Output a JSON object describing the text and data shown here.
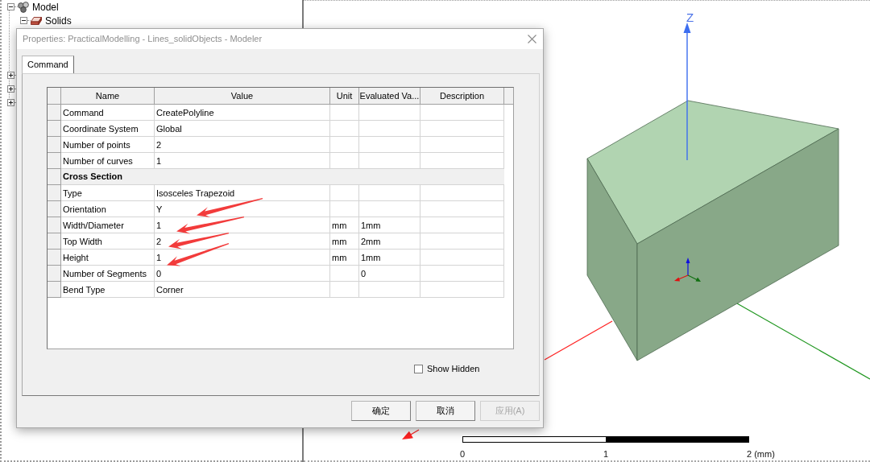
{
  "tree": {
    "items": [
      {
        "label": "Model",
        "expanded": true,
        "children": [
          {
            "label": "Solids",
            "expanded": true
          }
        ]
      },
      {
        "expanded": false
      },
      {
        "expanded": false
      },
      {
        "expanded": false
      }
    ]
  },
  "dialog": {
    "title": "Properties: PracticalModelling - Lines_solidObjects - Modeler",
    "tabs": [
      {
        "label": "Command",
        "selected": true
      }
    ],
    "table": {
      "columns": [
        "Name",
        "Value",
        "Unit",
        "Evaluated Va...",
        "Description"
      ],
      "rows": [
        {
          "kind": "property",
          "name": "Command",
          "value": "CreatePolyline",
          "arrow": false
        },
        {
          "kind": "property",
          "name": "Coordinate System",
          "value": "Global",
          "arrow": false
        },
        {
          "kind": "property",
          "name": "Number of points",
          "value": "2",
          "arrow": false
        },
        {
          "kind": "property",
          "name": "Number of curves",
          "value": "1",
          "arrow": false
        },
        {
          "kind": "section",
          "name": "Cross Section",
          "arrow": false
        },
        {
          "kind": "property",
          "name": "Type",
          "value": "Isosceles Trapezoid",
          "arrow": false
        },
        {
          "kind": "property",
          "name": "Orientation",
          "value": "Y",
          "arrow": true
        },
        {
          "kind": "property",
          "name": "Width/Diameter",
          "value": "1",
          "unit": "mm",
          "evaluated_value": "1mm",
          "arrow": true
        },
        {
          "kind": "property",
          "name": "Top Width",
          "value": "2",
          "unit": "mm",
          "evaluated_value": "2mm",
          "arrow": true
        },
        {
          "kind": "property",
          "name": "Height",
          "value": "1",
          "unit": "mm",
          "evaluated_value": "1mm",
          "arrow": true
        },
        {
          "kind": "property",
          "name": "Number of Segments",
          "value": "0",
          "evaluated_value": "0",
          "arrow": false
        },
        {
          "kind": "property",
          "name": "Bend Type",
          "value": "Corner",
          "arrow": false
        }
      ]
    },
    "show_hidden": {
      "label": "Show Hidden",
      "checked": false
    },
    "buttons": [
      {
        "label": "确定",
        "disabled": false
      },
      {
        "label": "取消",
        "disabled": false
      },
      {
        "label": "应用(A)",
        "disabled": true
      }
    ]
  },
  "view": {
    "axis_label": "Z",
    "scale_labels": [
      "0",
      "1",
      "2 (mm)"
    ]
  }
}
